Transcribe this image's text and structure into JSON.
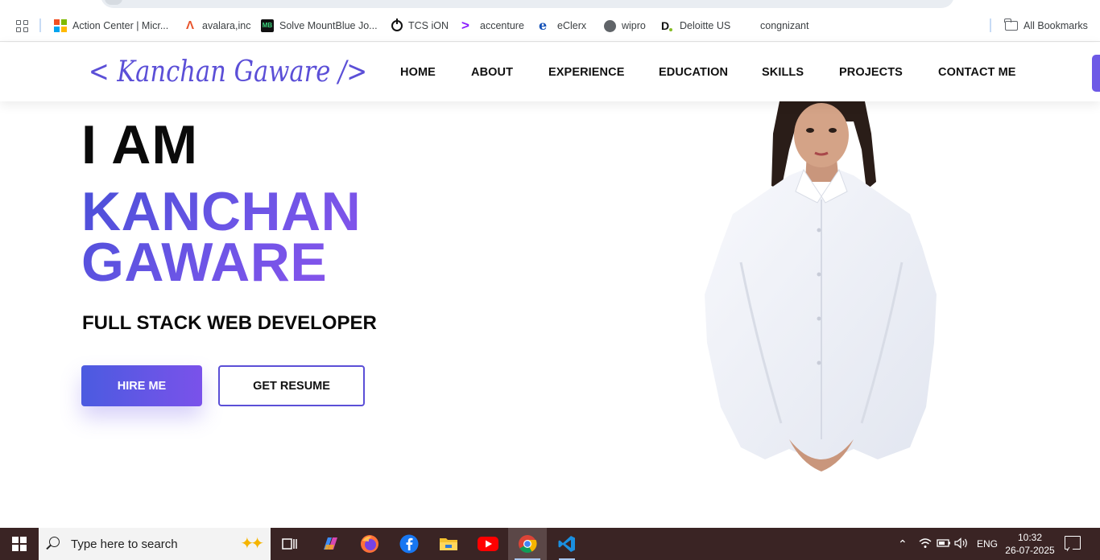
{
  "bookmarks": {
    "items": [
      {
        "label": "Action Center | Micr...",
        "icon": "microsoft-icon"
      },
      {
        "label": "avalara,inc",
        "icon": "avalara-icon"
      },
      {
        "label": "Solve MountBlue Jo...",
        "icon": "mountblue-icon"
      },
      {
        "label": "TCS iON",
        "icon": "tcs-ion-icon"
      },
      {
        "label": "accenture",
        "icon": "accenture-icon"
      },
      {
        "label": "eClerx",
        "icon": "eclerx-icon"
      },
      {
        "label": "wipro",
        "icon": "globe-icon"
      },
      {
        "label": "Deloitte US",
        "icon": "deloitte-icon"
      },
      {
        "label": "congnizant",
        "icon": ""
      }
    ],
    "all_bookmarks": "All Bookmarks"
  },
  "site": {
    "logo_text": "< Kanchan Gaware />",
    "nav": [
      "HOME",
      "ABOUT",
      "EXPERIENCE",
      "EDUCATION",
      "SKILLS",
      "PROJECTS",
      "CONTACT ME"
    ],
    "accent_color": "#5b4fd7"
  },
  "hero": {
    "intro": "I AM",
    "name_line1": "KANCHAN",
    "name_line2": "GAWARE",
    "role": "FULL STACK WEB DEVELOPER",
    "hire_button": "HIRE ME",
    "resume_button": "GET RESUME"
  },
  "taskbar": {
    "search_placeholder": "Type here to search",
    "apps": [
      "task-view-icon",
      "copilot-icon",
      "firefox-icon",
      "facebook-icon",
      "file-explorer-icon",
      "youtube-icon",
      "chrome-icon",
      "vscode-icon"
    ],
    "language": "ENG",
    "time": "10:32",
    "date": "26-07-2025"
  }
}
